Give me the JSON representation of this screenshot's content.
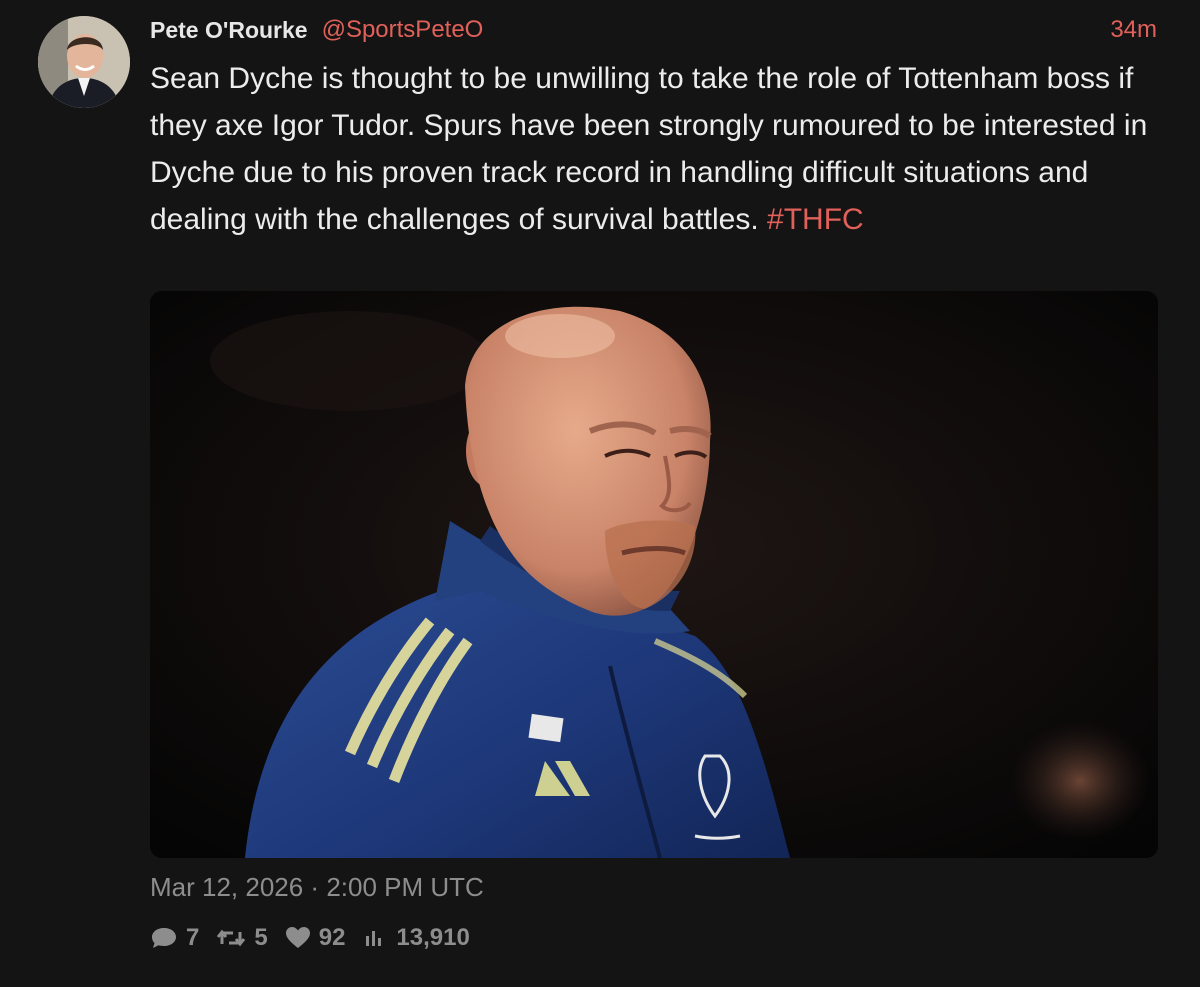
{
  "tweet": {
    "author_name": "Pete O'Rourke",
    "handle": "@SportsPeteO",
    "relative_time": "34m",
    "text": "Sean Dyche is thought to be unwilling to take the role of Tottenham boss if they axe Igor Tudor. Spurs have been strongly rumoured to be interested in Dyche due to his proven track record in handling difficult situations and dealing with the challenges of survival battles. ",
    "hashtag": "#THFC",
    "timestamp": "Mar 12, 2026 · 2:00 PM UTC",
    "stats": {
      "replies": "7",
      "retweets": "5",
      "likes": "92",
      "views": "13,910"
    }
  },
  "colors": {
    "background": "#141414",
    "accent": "#e0605a",
    "text": "#ececec",
    "muted": "#8d8d8d"
  },
  "icons": {
    "reply": "speech-bubble-icon",
    "retweet": "retweet-icon",
    "like": "heart-icon",
    "views": "bar-chart-icon"
  }
}
